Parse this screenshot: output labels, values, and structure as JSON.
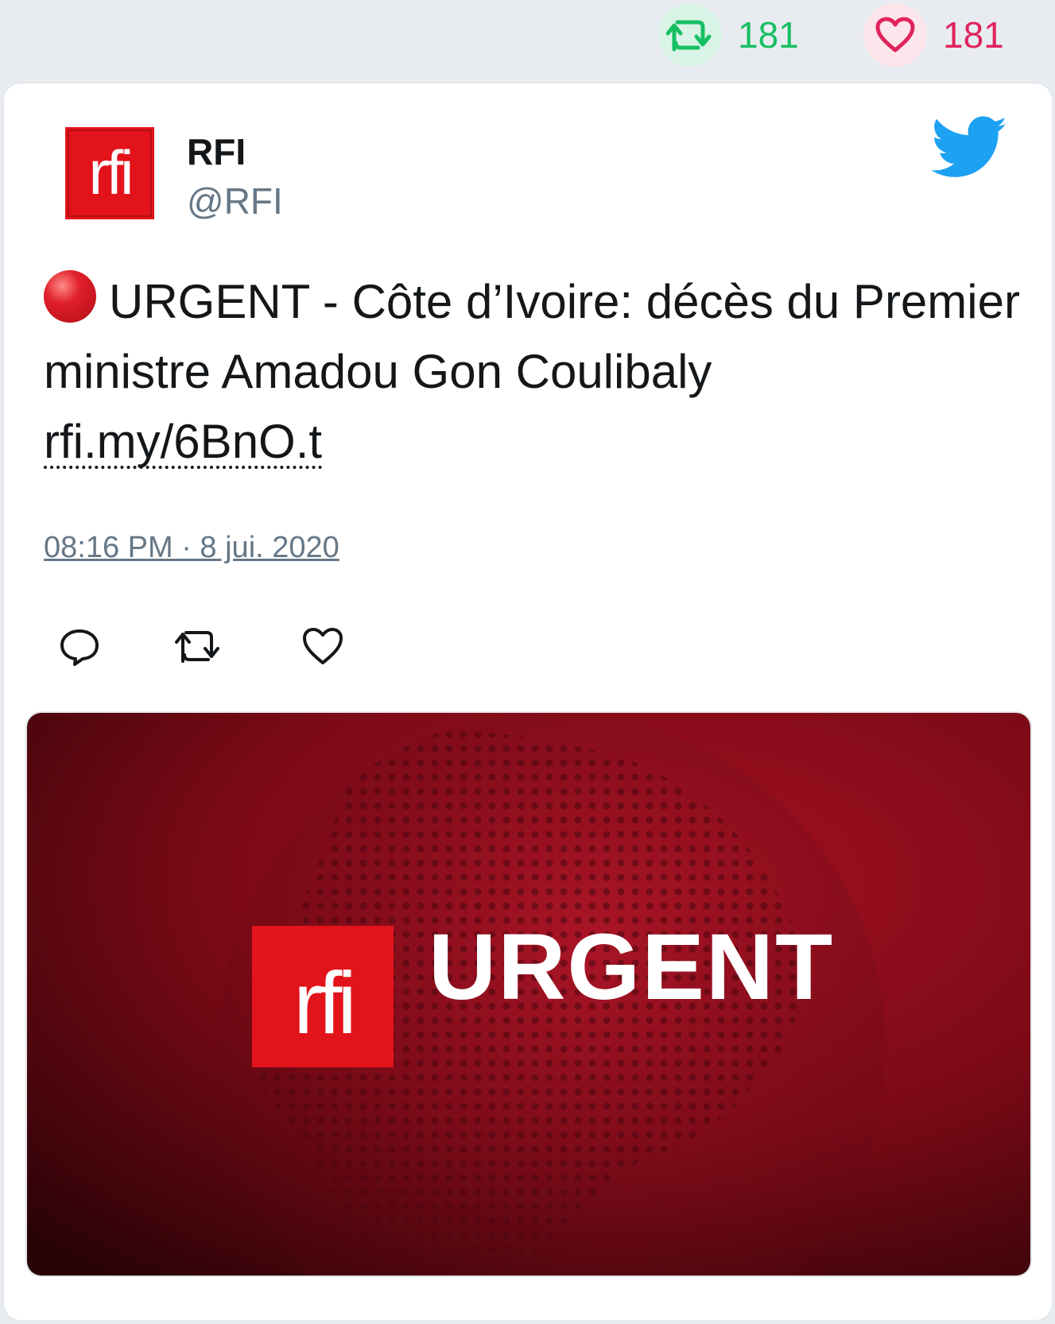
{
  "stats": {
    "retweet_count": "181",
    "like_count": "181",
    "retweet_icon": "retweet-icon",
    "like_icon": "heart-icon",
    "retweet_color": "#17bf63",
    "like_color": "#e0245e"
  },
  "author": {
    "name": "RFI",
    "handle": "@RFI",
    "avatar_text": "rfi"
  },
  "tweet": {
    "text": "URGENT - Côte d’Ivoire: décès du Premier ministre Amadou Gon Coulibaly",
    "link": "rfi.my/6BnO.t",
    "timestamp": "08:16 PM · 8 jui. 2020"
  },
  "media": {
    "logo_text": "rfi",
    "headline": "URGENT"
  },
  "colors": {
    "twitter_blue": "#1da1f2",
    "rfi_red": "#e3131b"
  }
}
